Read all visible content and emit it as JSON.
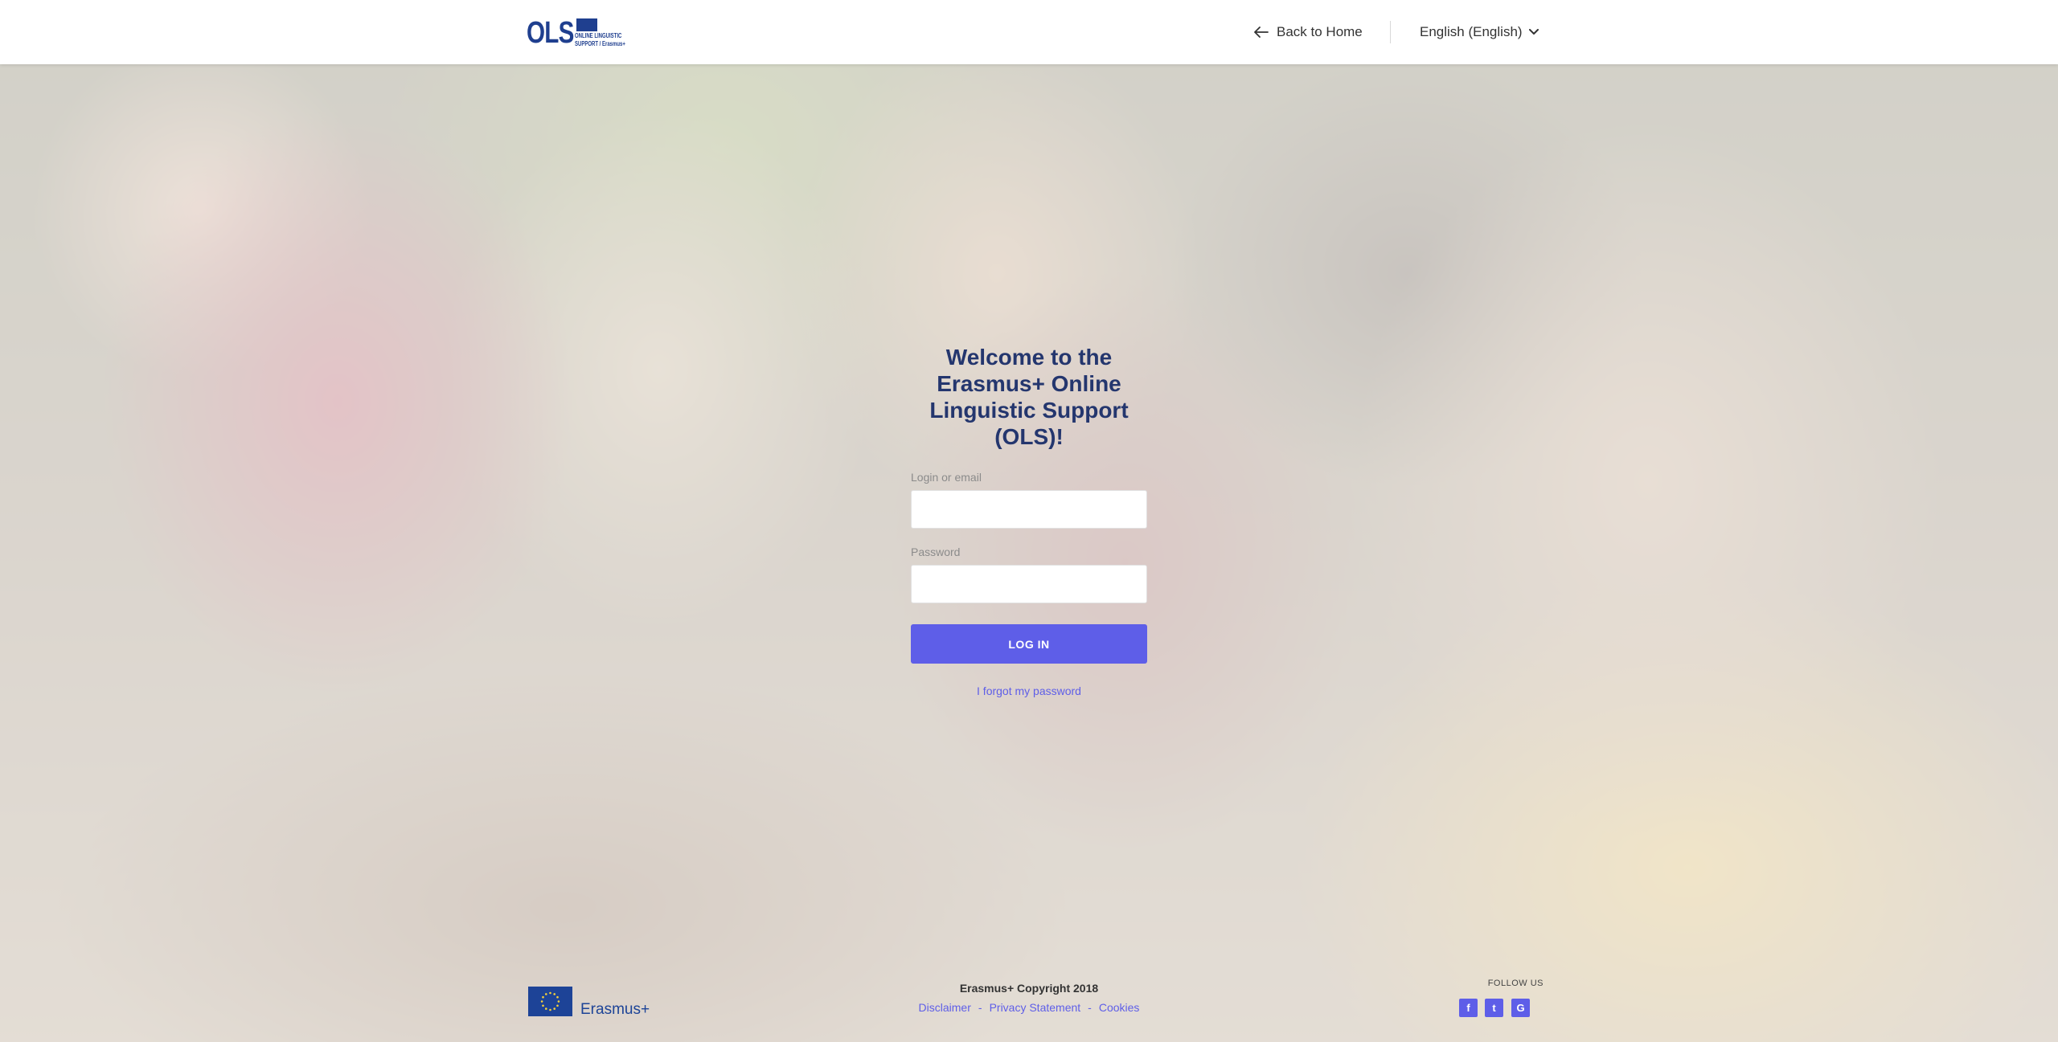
{
  "header": {
    "logo": {
      "text": "OLS",
      "line1": "ONLINE LINGUISTIC",
      "line2": "SUPPORT / Erasmus+"
    },
    "back_label": "Back to Home",
    "language_label": "English (English)"
  },
  "login": {
    "title": "Welcome to the Erasmus+ Online Linguistic Support (OLS)!",
    "login_label": "Login or email",
    "login_value": "",
    "password_label": "Password",
    "password_value": "",
    "button_label": "LOG IN",
    "forgot_label": "I forgot my password"
  },
  "footer": {
    "brand": "Erasmus+",
    "copyright": "Erasmus+ Copyright 2018",
    "links": [
      "Disclaimer",
      "Privacy Statement",
      "Cookies"
    ],
    "separator": "-",
    "follow_label": "FOLLOW US",
    "social": [
      {
        "icon": "facebook-icon",
        "glyph": "f"
      },
      {
        "icon": "twitter-icon",
        "glyph": "t"
      },
      {
        "icon": "google-icon",
        "glyph": "G"
      }
    ]
  },
  "colors": {
    "accent": "#5e5ee8",
    "title": "#24366e",
    "brand_blue": "#1f3f8f"
  }
}
